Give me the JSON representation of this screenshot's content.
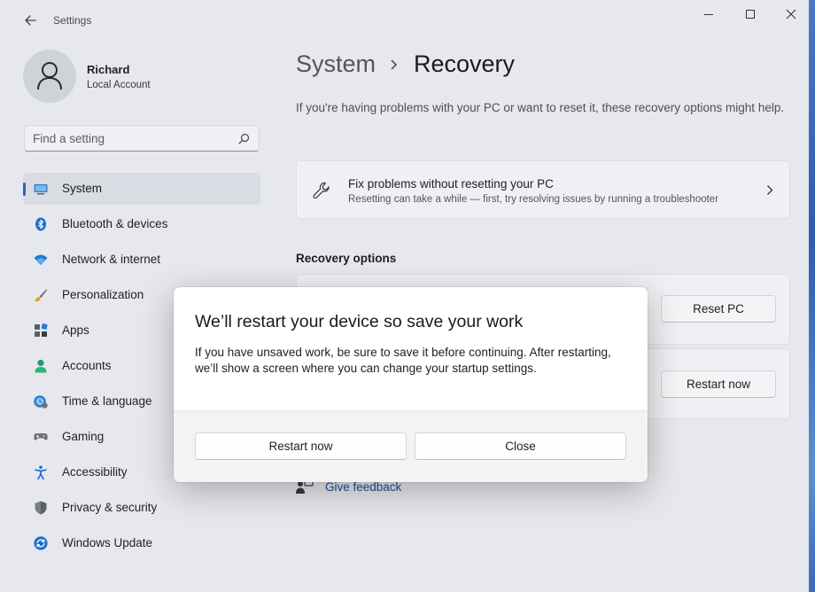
{
  "window": {
    "app_title": "Settings"
  },
  "user": {
    "name": "Richard",
    "account_type": "Local Account"
  },
  "search": {
    "placeholder": "Find a setting"
  },
  "sidebar": {
    "items": [
      {
        "label": "System",
        "icon": "system-icon",
        "selected": true
      },
      {
        "label": "Bluetooth & devices",
        "icon": "bluetooth-icon"
      },
      {
        "label": "Network & internet",
        "icon": "wifi-icon"
      },
      {
        "label": "Personalization",
        "icon": "brush-icon"
      },
      {
        "label": "Apps",
        "icon": "apps-icon"
      },
      {
        "label": "Accounts",
        "icon": "person-icon"
      },
      {
        "label": "Time & language",
        "icon": "clock-globe-icon"
      },
      {
        "label": "Gaming",
        "icon": "gamepad-icon"
      },
      {
        "label": "Accessibility",
        "icon": "accessibility-icon"
      },
      {
        "label": "Privacy & security",
        "icon": "shield-icon"
      },
      {
        "label": "Windows Update",
        "icon": "update-icon"
      }
    ]
  },
  "breadcrumb": {
    "parent": "System",
    "current": "Recovery"
  },
  "intro": "If you're having problems with your PC or want to reset it, these recovery options might help.",
  "fix_card": {
    "title": "Fix problems without resetting your PC",
    "subtitle": "Resetting can take a while — first, try resolving issues by running a troubleshooter"
  },
  "recovery_options": {
    "title": "Recovery options",
    "reset_button": "Reset PC",
    "restart_button": "Restart now"
  },
  "feedback": {
    "label": "Give feedback"
  },
  "dialog": {
    "title": "We’ll restart your device so save your work",
    "body": "If you have unsaved work, be sure to save it before continuing. After restarting, we’ll show a screen where you can change your startup settings.",
    "primary_button": "Restart now",
    "secondary_button": "Close"
  },
  "colors": {
    "accent": "#2a64b9",
    "link": "#1f4e96"
  }
}
